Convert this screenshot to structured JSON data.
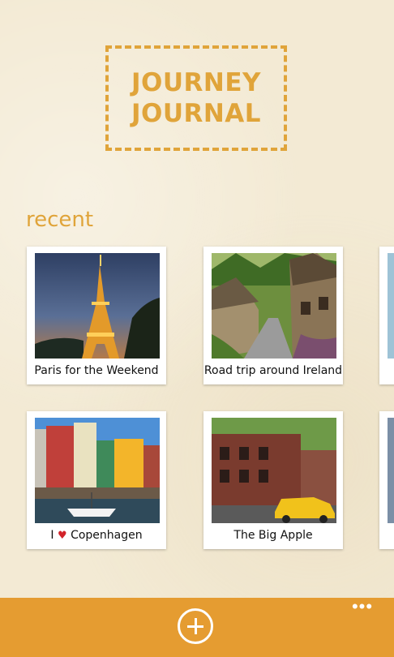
{
  "app": {
    "logo_line1": "JOURNEY",
    "logo_line2": "JOURNAL",
    "accent_color": "#e0a43a",
    "appbar_color": "#e59c31"
  },
  "recent": {
    "title": "recent",
    "journals": [
      {
        "caption": "Paris for the Weekend",
        "photo_icon": "eiffel-tower-photo"
      },
      {
        "caption": "Road trip around Ireland",
        "photo_icon": "village-street-photo"
      },
      {
        "caption_prefix": "I",
        "caption_heart": "♥",
        "caption_suffix": "Copenhagen",
        "photo_icon": "nyhavn-harbor-photo"
      },
      {
        "caption": "The Big Apple",
        "photo_icon": "new-york-taxi-photo"
      }
    ]
  },
  "appbar": {
    "add_icon": "plus-circle-icon",
    "more_label": "•••"
  }
}
